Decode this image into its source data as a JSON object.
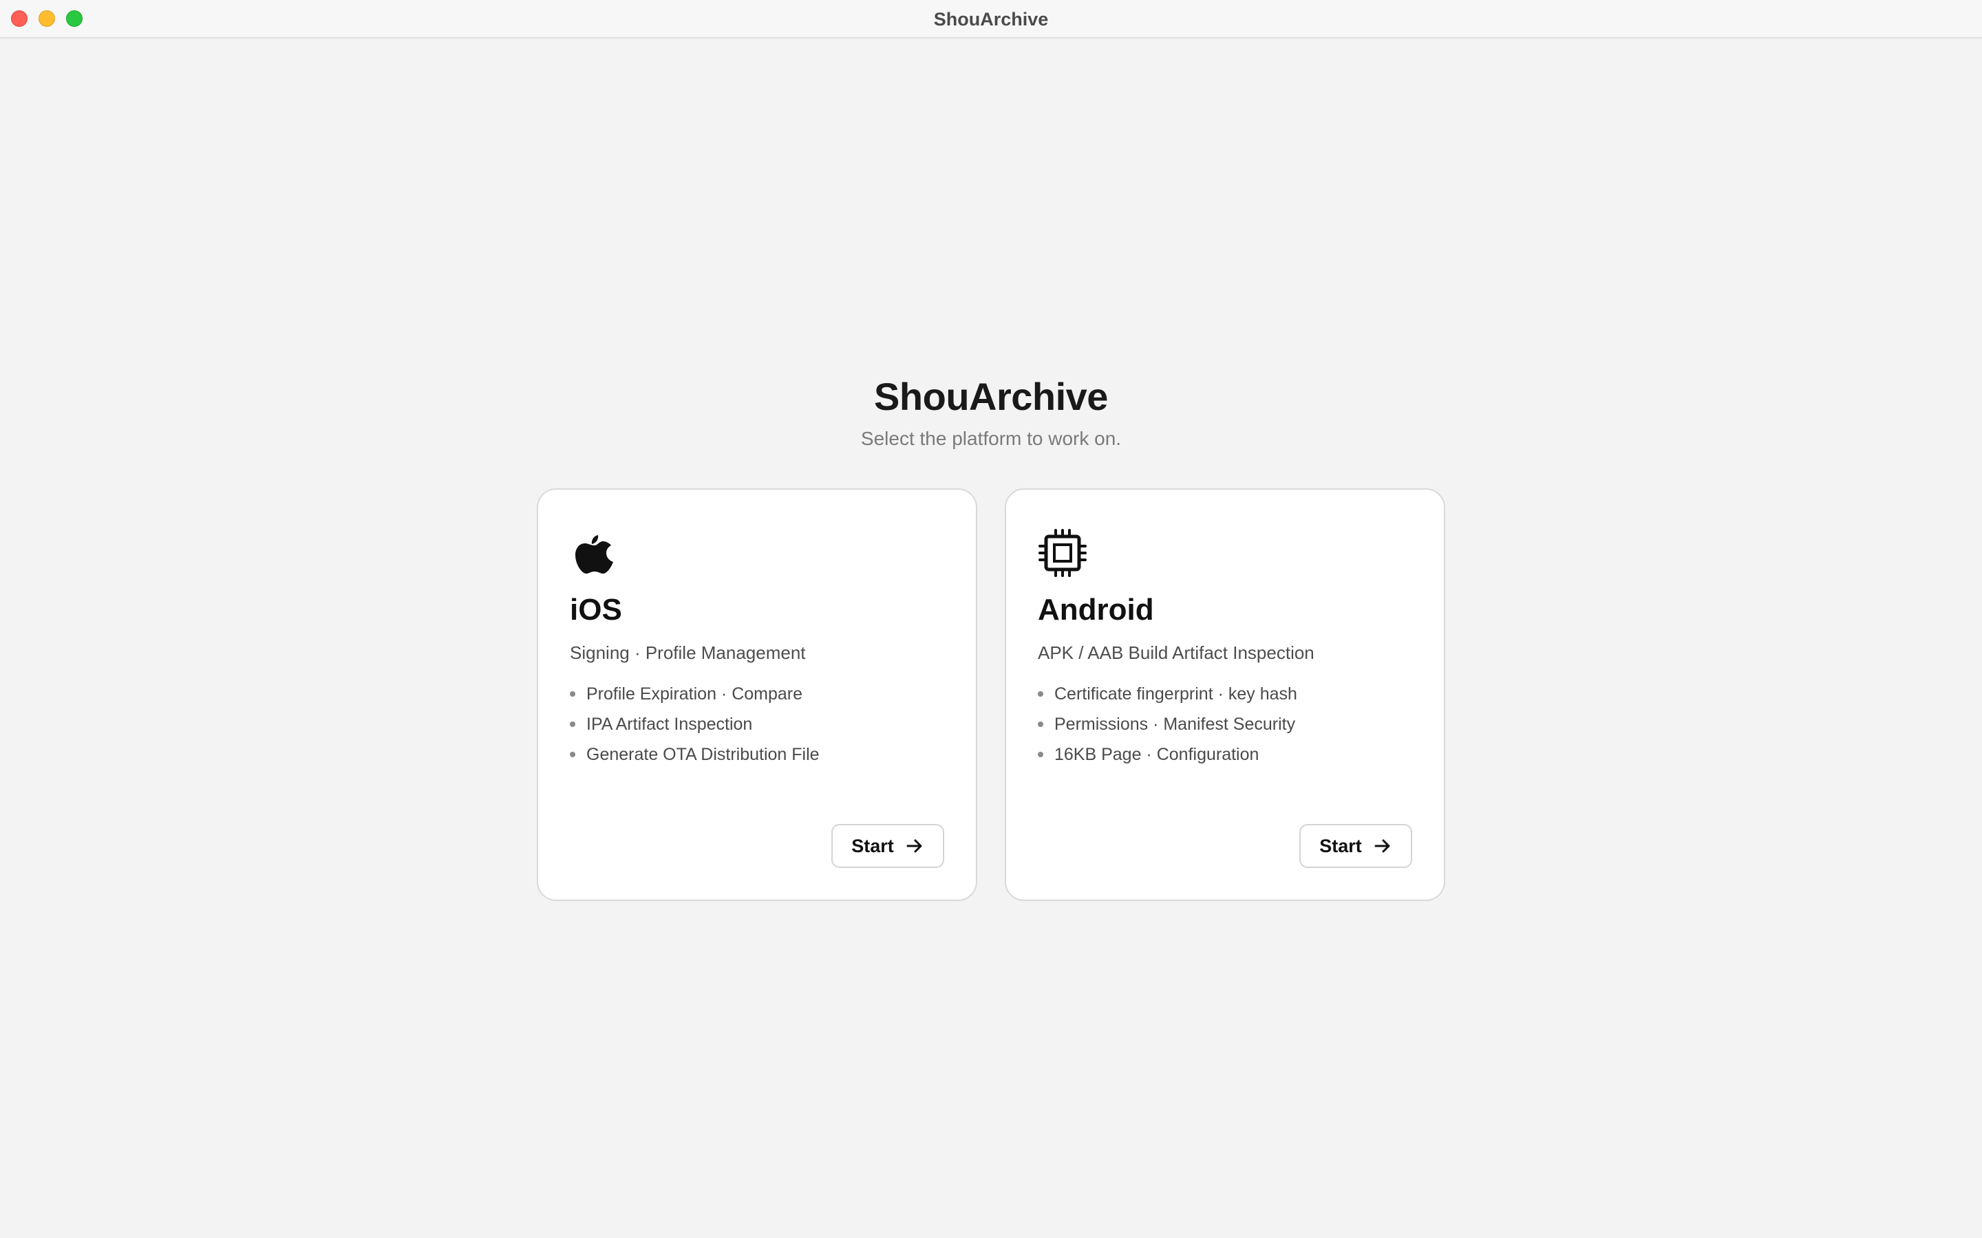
{
  "window": {
    "title": "ShouArchive",
    "controls": [
      "close-button",
      "minimize-button",
      "maximize-button"
    ]
  },
  "main": {
    "title": "ShouArchive",
    "subtitle": "Select the platform to work on."
  },
  "cards": [
    {
      "icon": "apple-logo-icon",
      "title": "iOS",
      "subtitle": "Signing · Profile Management",
      "features": [
        "Profile Expiration · Compare",
        "IPA Artifact Inspection",
        "Generate OTA Distribution File"
      ],
      "button_label": "Start",
      "button_icon": "arrow-right-icon"
    },
    {
      "icon": "chip-icon",
      "title": "Android",
      "subtitle": "APK / AAB Build Artifact Inspection",
      "features": [
        "Certificate fingerprint · key hash",
        "Permissions · Manifest Security",
        "16KB Page · Configuration"
      ],
      "button_label": "Start",
      "button_icon": "arrow-right-icon"
    }
  ],
  "colors": {
    "background": "#f3f3f3",
    "card": "#ffffff",
    "text_primary": "#111111",
    "text_secondary": "#7a7a7a",
    "close": "#ff5f57",
    "minimize": "#febc2e",
    "maximize": "#28c840"
  }
}
